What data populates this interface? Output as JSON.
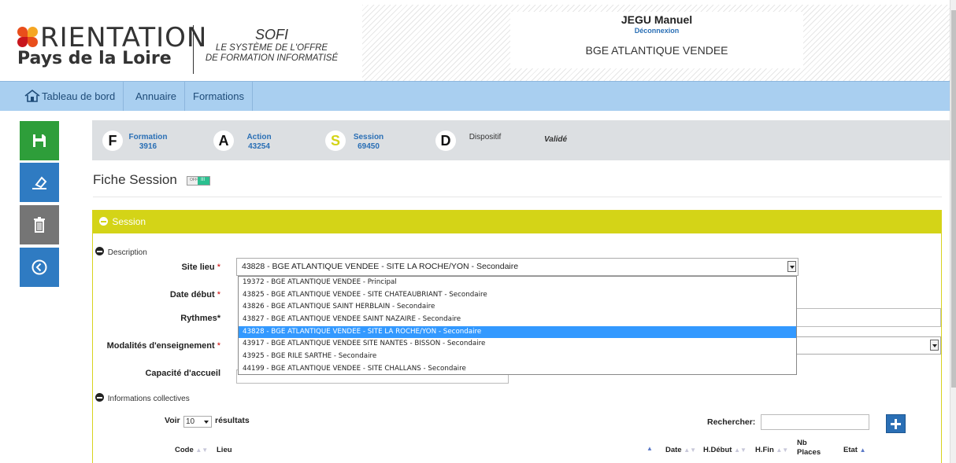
{
  "header": {
    "logo_top": "RIENTATION",
    "logo_bottom": "Pays de la Loire",
    "app_title": "SOFI",
    "app_subtitle_1": "LE SYSTÈME DE L'OFFRE",
    "app_subtitle_2": "DE FORMATION INFORMATISÉ",
    "user_name": "JEGU Manuel",
    "logout": "Déconnexion",
    "organization": "BGE ATLANTIQUE VENDEE"
  },
  "nav": {
    "items": [
      "Tableau de bord",
      "Annuaire",
      "Formations"
    ]
  },
  "sidebar": {
    "icons": [
      "save-icon",
      "eraser-icon",
      "trash-icon",
      "back-arrow-icon"
    ],
    "colors": [
      "#2e9e3a",
      "#2f7bc2",
      "#757575",
      "#2f7bc2"
    ]
  },
  "breadcrumb": {
    "steps": [
      {
        "letter": "F",
        "label": "Formation",
        "id": "3916"
      },
      {
        "letter": "A",
        "label": "Action",
        "id": "43254"
      },
      {
        "letter": "S",
        "label": "Session",
        "id": "69450"
      },
      {
        "letter": "D",
        "label": "Dispositif",
        "id": ""
      }
    ],
    "status": "Validé"
  },
  "page": {
    "title": "Fiche Session",
    "toggle_off": "OFF",
    "toggle_on": "III"
  },
  "panel": {
    "title": "Session",
    "description_label": "Description",
    "fields": {
      "site_lieu": "Site lieu",
      "date_debut": "Date début",
      "rythmes": "Rythmes*",
      "modalites": "Modalités d'enseignement",
      "capacite": "Capacité d'accueil",
      "required_mark": " *"
    },
    "site_lieu_value": "43828 - BGE ATLANTIQUE VENDEE - SITE LA ROCHE/YON - Secondaire",
    "site_lieu_options": [
      "19372 - BGE ATLANTIQUE VENDEE - Principal",
      "43825 - BGE ATLANTIQUE VENDEE - SITE CHATEAUBRIANT - Secondaire",
      "43826 - BGE ATLANTIQUE SAINT HERBLAIN - Secondaire",
      "43827 - BGE ATLANTIQUE VENDEE SAINT NAZAIRE - Secondaire",
      "43828 - BGE ATLANTIQUE VENDEE - SITE LA ROCHE/YON - Secondaire",
      "43917 - BGE ATLANTIQUE VENDEE SITE NANTES - BISSON - Secondaire",
      "43925 - BGE RILE SARTHE - Secondaire",
      "44199 - BGE ATLANTIQUE VENDEE - SITE CHALLANS - Secondaire"
    ],
    "selected_option_index": 4,
    "info_collectives_label": "Informations collectives",
    "voir": "Voir",
    "voir_value": "10",
    "resultats": "résultats",
    "rechercher": "Rechercher:",
    "table_headers": [
      "Code",
      "Lieu",
      "Date",
      "H.Début",
      "H.Fin",
      "Nb Places",
      "Etat"
    ]
  }
}
